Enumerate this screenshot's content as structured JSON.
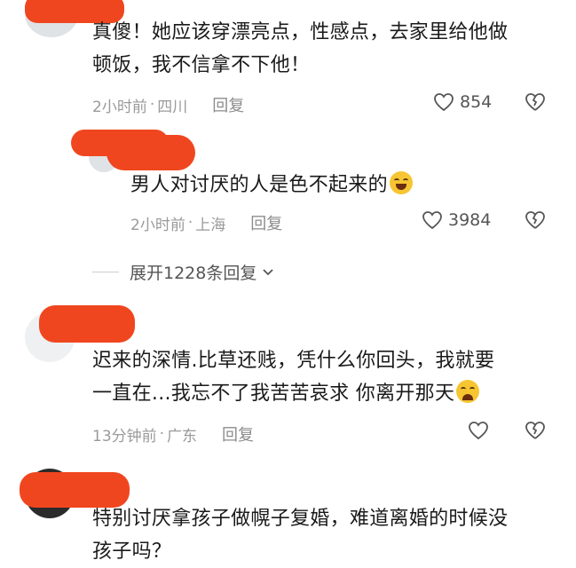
{
  "comments": [
    {
      "text_line1": "真傻！她应该穿漂亮点，性感点，去家里给他做",
      "text_line2": "顿饭，我不信拿不下他！",
      "time": "2小时前",
      "location": "四川",
      "reply_label": "回复",
      "likes": "854"
    },
    {
      "text_line1": "男人对讨厌的人是色不起来的",
      "emoji": "grinning-sweat-emoji",
      "time": "2小时前",
      "location": "上海",
      "reply_label": "回复",
      "likes": "3984"
    },
    {
      "text_line1": "迟来的深情.比草还贱，凭什么你回头，我就要",
      "text_line2": "一直在...我忘不了我苦苦哀求 你离开那天",
      "emoji": "crying-emoji",
      "time": "13分钟前",
      "location": "广东",
      "reply_label": "回复"
    },
    {
      "text_line1": "特别讨厌拿孩子做幌子复婚，难道离婚的时候没",
      "text_line2": "孩子吗？"
    }
  ],
  "expand_replies": "展开1228条回复",
  "separator": "·",
  "colors": {
    "redaction": "#f0461f",
    "meta_gray": "#9a9a9a"
  }
}
